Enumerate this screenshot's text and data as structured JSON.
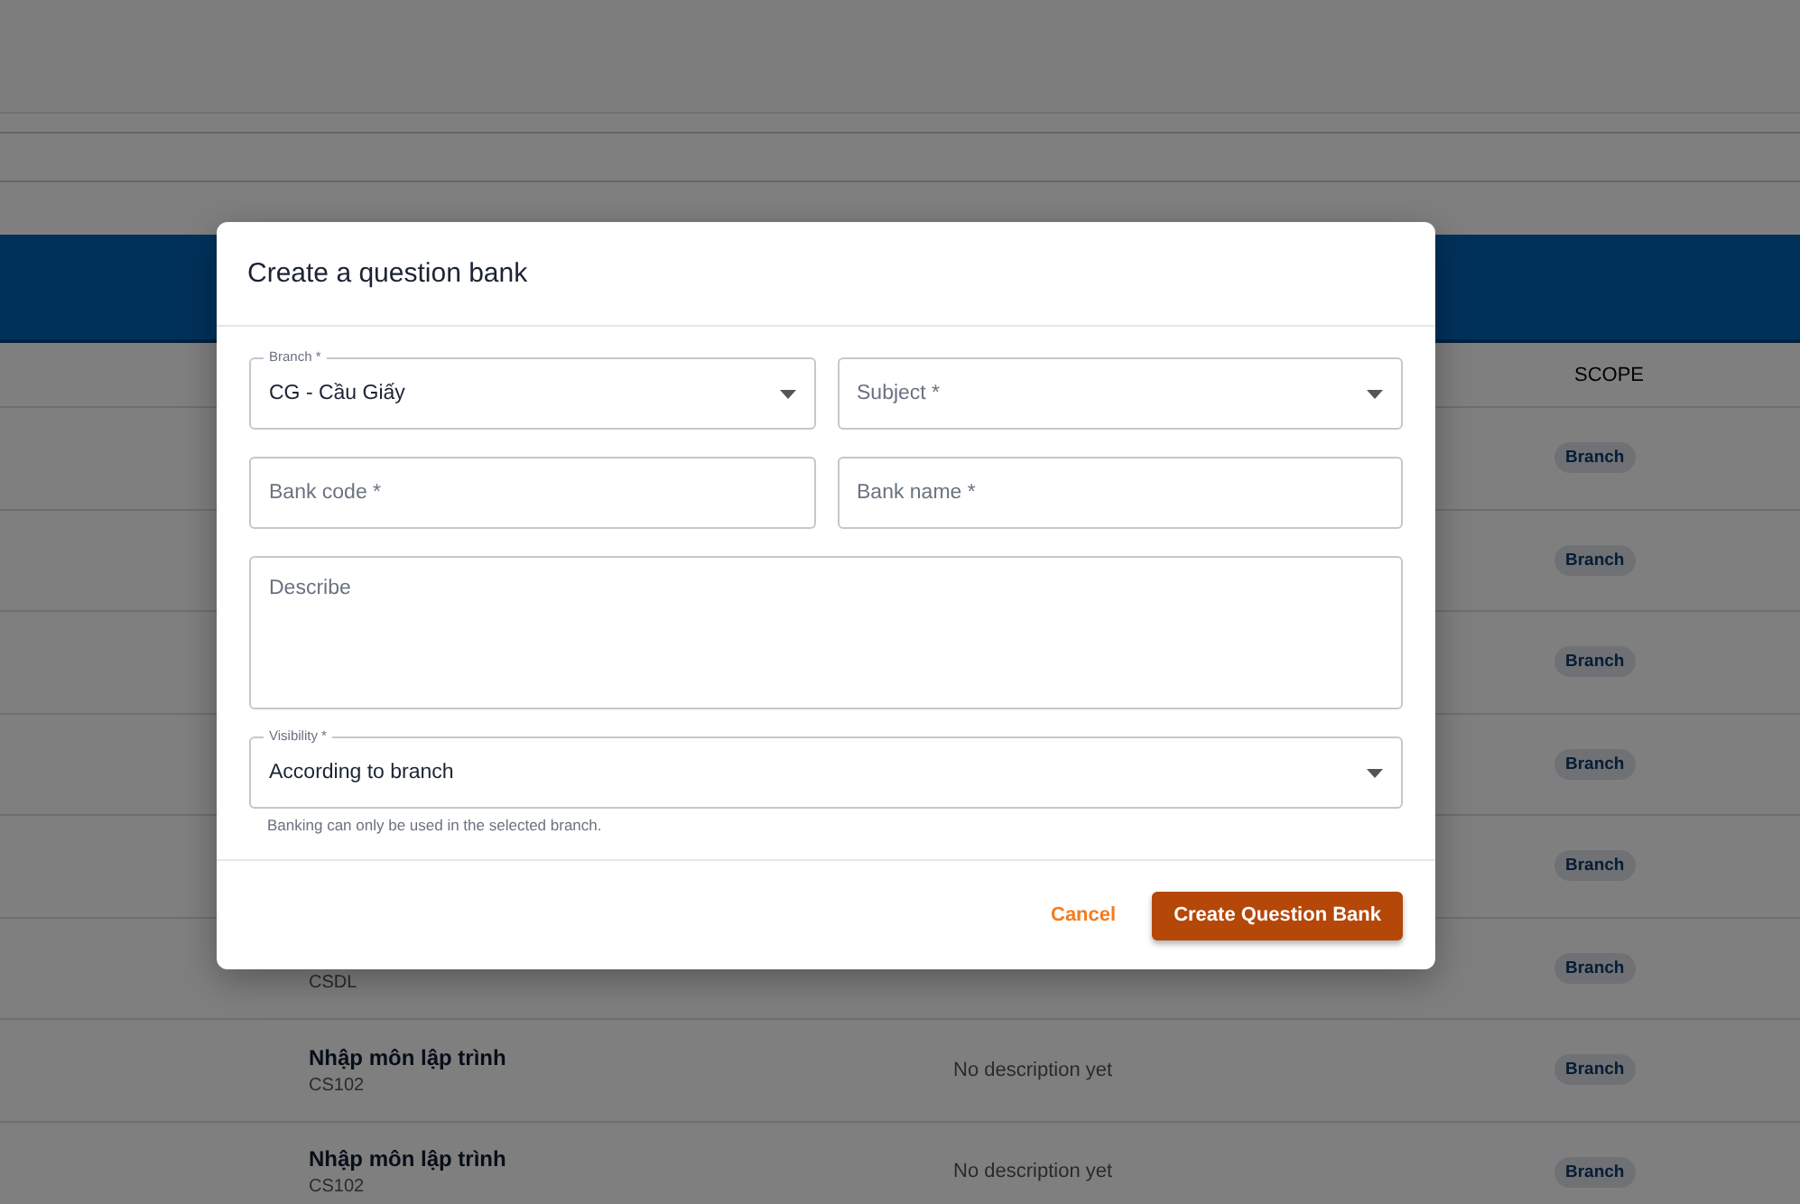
{
  "table": {
    "columns": [
      {
        "label": "SCOPE"
      }
    ],
    "rows": [
      {
        "scope": "Branch"
      },
      {
        "scope": "Branch"
      },
      {
        "scope": "Branch"
      },
      {
        "scope": "Branch"
      },
      {
        "scope": "Branch"
      },
      {
        "code": "CSDL",
        "scope": "Branch"
      },
      {
        "title": "Nhập môn lập trình",
        "code": "CS102",
        "description": "No description yet",
        "scope": "Branch"
      },
      {
        "title": "Nhập môn lập trình",
        "code": "CS102",
        "description": "No description yet",
        "scope": "Branch"
      }
    ]
  },
  "dialog": {
    "title": "Create a question bank",
    "fields": [
      {
        "kind": "select",
        "label": "Branch *",
        "value": "CG - Cầu Giấy"
      },
      {
        "kind": "select",
        "placeholder": "Subject *"
      },
      {
        "kind": "input",
        "placeholder": "Bank code *"
      },
      {
        "kind": "input",
        "placeholder": "Bank name *"
      },
      {
        "kind": "textarea",
        "placeholder": "Describe"
      },
      {
        "kind": "select",
        "label": "Visibility *",
        "value": "According to branch",
        "helper": "Banking can only be used in the selected branch."
      }
    ],
    "buttons": [
      {
        "label": "Cancel",
        "kind": "text"
      },
      {
        "label": "Create Question Bank",
        "kind": "primary"
      }
    ]
  }
}
